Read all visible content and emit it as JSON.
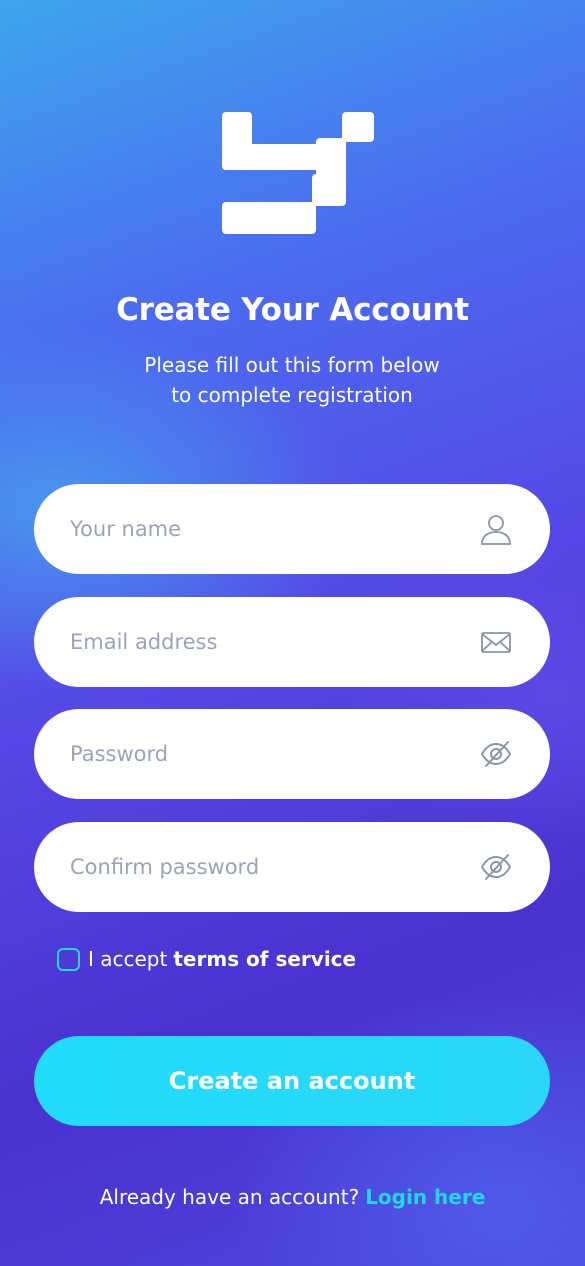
{
  "brand": {
    "logo_icon": "brand-logo-icon"
  },
  "header": {
    "title": "Create Your Account",
    "subtitle_line1": "Please fill out this form below",
    "subtitle_line2": "to complete registration"
  },
  "form": {
    "name": {
      "placeholder": "Your name",
      "value": "",
      "icon": "user-icon"
    },
    "email": {
      "placeholder": "Email address",
      "value": "",
      "icon": "envelope-icon"
    },
    "password": {
      "placeholder": "Password",
      "value": "",
      "icon": "eye-off-icon"
    },
    "confirm_password": {
      "placeholder": "Confirm password",
      "value": "",
      "icon": "eye-off-icon"
    },
    "terms": {
      "prefix": "I accept",
      "link": "terms of service",
      "checked": false
    },
    "submit_label": "Create an account"
  },
  "footer": {
    "prompt": "Already have an account?",
    "link": "Login here"
  },
  "colors": {
    "accent": "#23D6F5",
    "field_background": "#FFFFFF",
    "placeholder": "#9AA4B6",
    "icon_stroke": "#8A94A8"
  }
}
